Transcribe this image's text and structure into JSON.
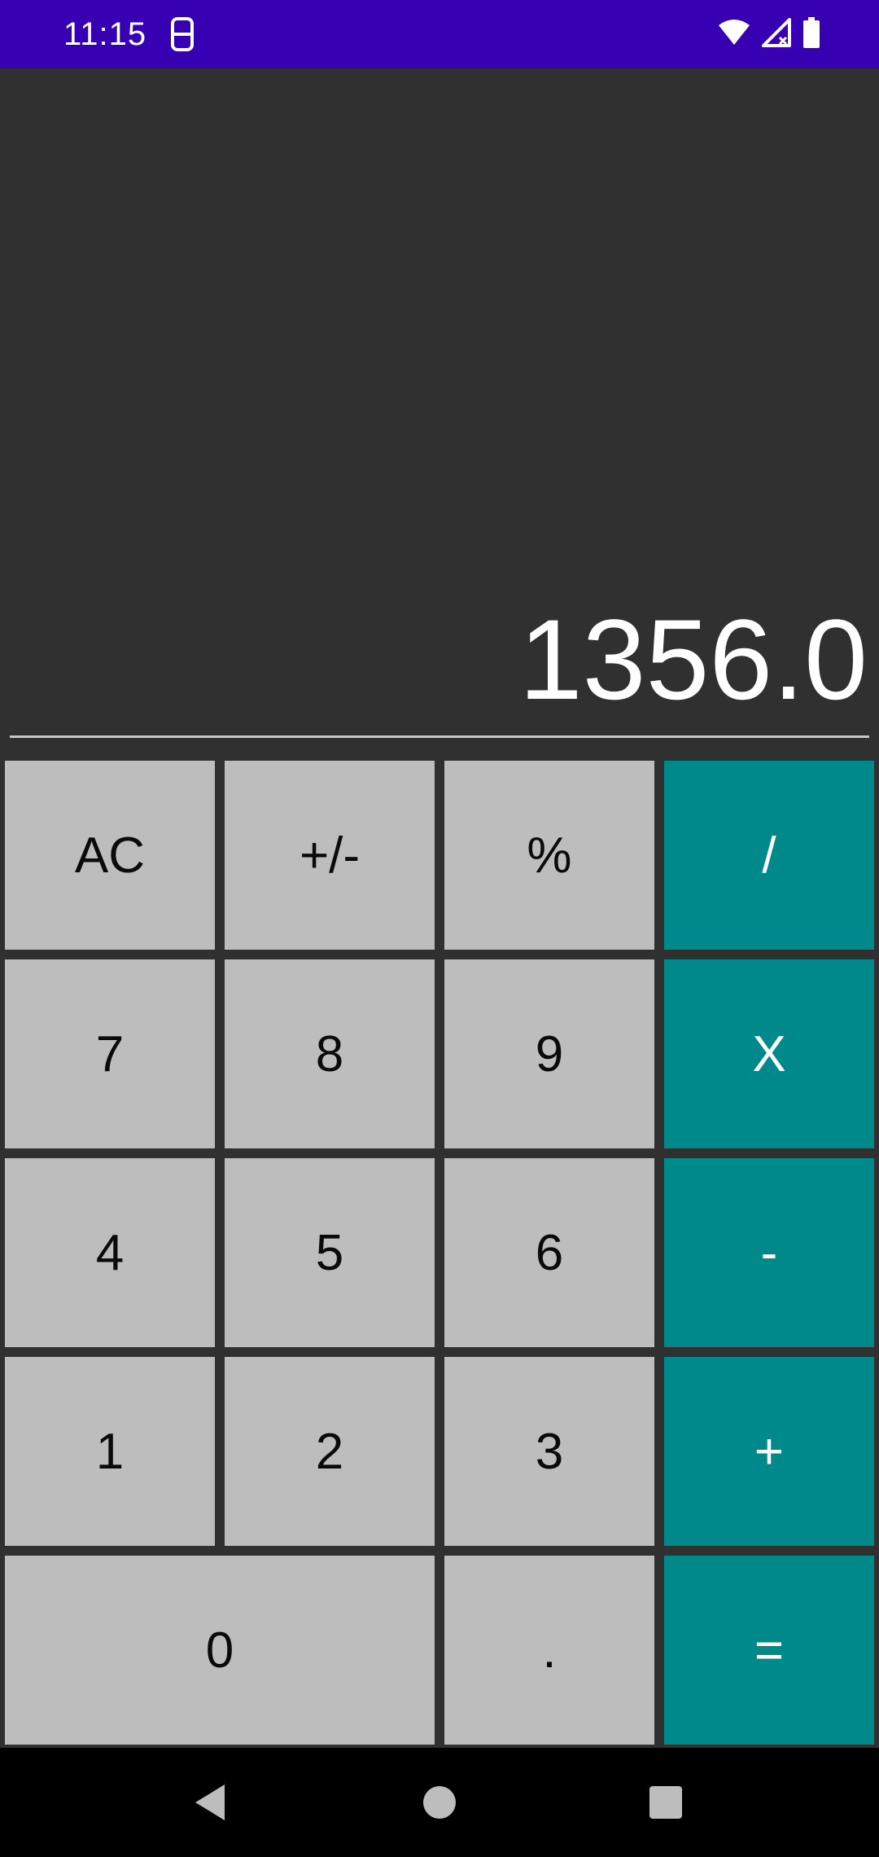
{
  "status_bar": {
    "time": "11:15",
    "left_icon": "sim-card-alert-icon",
    "right_icons": [
      "wifi-icon",
      "signal-icon",
      "battery-icon"
    ],
    "color": "#3700b3"
  },
  "display": {
    "result": "1356.0"
  },
  "keypad": {
    "rows": [
      [
        {
          "label": "AC",
          "type": "function"
        },
        {
          "label": "+/-",
          "type": "function"
        },
        {
          "label": "%",
          "type": "function"
        },
        {
          "label": "/",
          "type": "operator"
        }
      ],
      [
        {
          "label": "7",
          "type": "digit"
        },
        {
          "label": "8",
          "type": "digit"
        },
        {
          "label": "9",
          "type": "digit"
        },
        {
          "label": "X",
          "type": "operator"
        }
      ],
      [
        {
          "label": "4",
          "type": "digit"
        },
        {
          "label": "5",
          "type": "digit"
        },
        {
          "label": "6",
          "type": "digit"
        },
        {
          "label": "-",
          "type": "operator"
        }
      ],
      [
        {
          "label": "1",
          "type": "digit"
        },
        {
          "label": "2",
          "type": "digit"
        },
        {
          "label": "3",
          "type": "digit"
        },
        {
          "label": "+",
          "type": "operator"
        }
      ],
      [
        {
          "label": "0",
          "type": "digit"
        },
        {
          "label": ".",
          "type": "digit"
        },
        {
          "label": "=",
          "type": "operator"
        }
      ]
    ],
    "colors": {
      "key": "#bdbdbd",
      "operator": "#00898a",
      "background": "#303030"
    }
  },
  "nav_bar": {
    "buttons": [
      "back-icon",
      "home-icon",
      "recents-icon"
    ]
  }
}
